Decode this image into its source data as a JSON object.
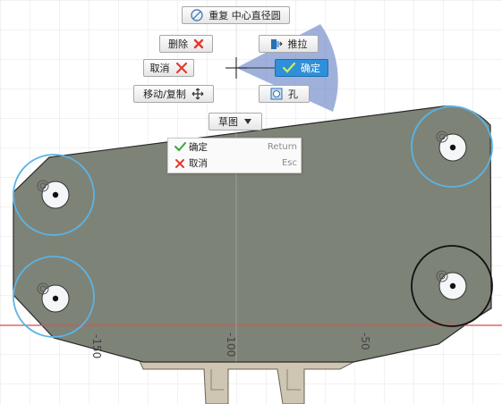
{
  "marking_menu": {
    "top_button": "重复 中心直径圆",
    "delete": "删除",
    "cancel": "取消",
    "move_copy": "移动/复制",
    "press_pull": "推拉",
    "ok": "确定",
    "hole": "孔",
    "sketch": "草图"
  },
  "context_menu": {
    "items": [
      {
        "label": "确定",
        "shortcut": "Return",
        "icon": "check-icon"
      },
      {
        "label": "取消",
        "shortcut": "Esc",
        "icon": "close-icon"
      }
    ]
  },
  "ruler": {
    "labels": [
      "-150",
      "-100",
      "-50"
    ]
  },
  "colors": {
    "body_face": "#7e8377",
    "selection_circle": "#5ab4e6",
    "ok_active": "#2f8fd8",
    "x_axis": "#d9534f",
    "lower_part": "#cfc5b3"
  }
}
